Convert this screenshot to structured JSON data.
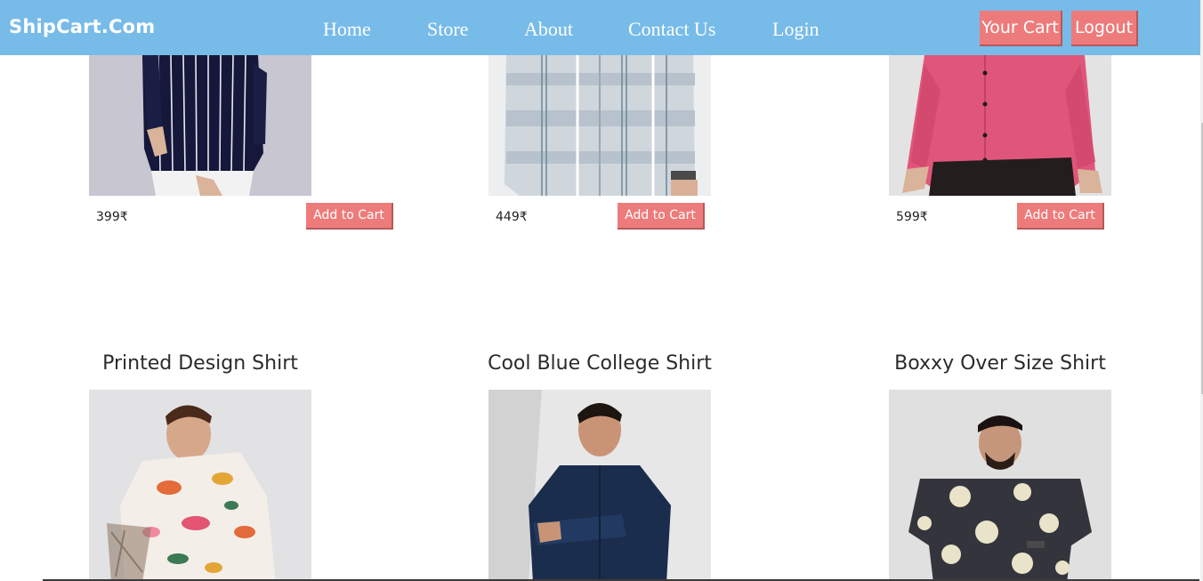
{
  "navbar": {
    "brand": "ShipCart.Com",
    "links": [
      {
        "label": "Home"
      },
      {
        "label": "Store"
      },
      {
        "label": "About"
      },
      {
        "label": "Contact Us"
      },
      {
        "label": "Login"
      }
    ],
    "cart_button": "Your Cart",
    "logout_button": "Logout"
  },
  "colors": {
    "navbar_bg": "#77bbe9",
    "button_bg": "#ee7b7b",
    "text_dark": "#2b2b2b"
  },
  "products_top_row": [
    {
      "price": "399₹",
      "button": "Add to Cart",
      "image": "navy-striped-shirt"
    },
    {
      "price": "449₹",
      "button": "Add to Cart",
      "image": "grey-check-shirt"
    },
    {
      "price": "599₹",
      "button": "Add to Cart",
      "image": "pink-shirt"
    }
  ],
  "products_second_row": [
    {
      "title": "Printed Design Shirt",
      "image": "floral-printed-shirt"
    },
    {
      "title": "Cool Blue College Shirt",
      "image": "navy-college-shirt"
    },
    {
      "title": "Boxxy Over Size Shirt",
      "image": "flower-oversize-shirt"
    }
  ]
}
